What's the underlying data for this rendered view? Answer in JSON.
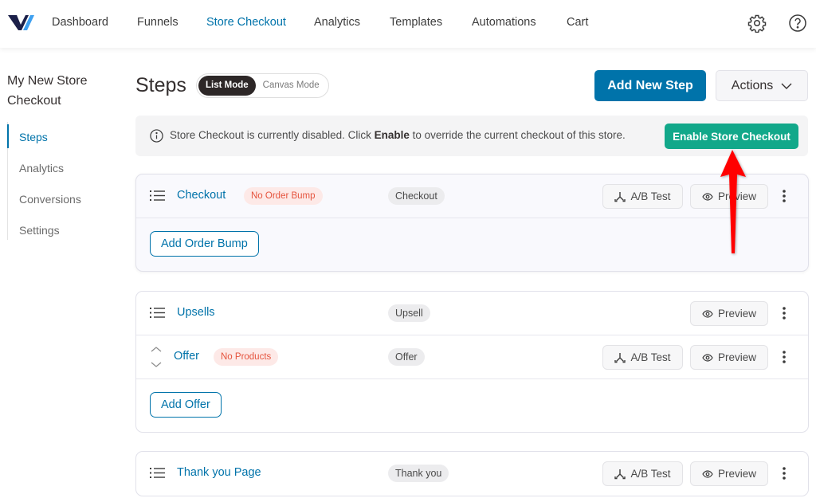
{
  "topnav": {
    "logo": "funnelkit-logo",
    "items": [
      {
        "label": "Dashboard",
        "active": false
      },
      {
        "label": "Funnels",
        "active": false
      },
      {
        "label": "Store Checkout",
        "active": true
      },
      {
        "label": "Analytics",
        "active": false
      },
      {
        "label": "Templates",
        "active": false
      },
      {
        "label": "Automations",
        "active": false
      },
      {
        "label": "Cart",
        "active": false
      }
    ],
    "icons": [
      "gear-icon",
      "help-icon"
    ]
  },
  "sidebar": {
    "title": "My New Store Checkout",
    "items": [
      {
        "label": "Steps",
        "active": true
      },
      {
        "label": "Analytics",
        "active": false
      },
      {
        "label": "Conversions",
        "active": false
      },
      {
        "label": "Settings",
        "active": false
      }
    ]
  },
  "header": {
    "title": "Steps",
    "modes": [
      {
        "label": "List Mode",
        "active": true
      },
      {
        "label": "Canvas Mode",
        "active": false
      }
    ],
    "add_step_label": "Add New Step",
    "actions_label": "Actions"
  },
  "notice": {
    "text_before": "Store Checkout is currently disabled. Click ",
    "text_bold": "Enable",
    "text_after": " to override the current checkout of this store.",
    "button_label": "Enable Store Checkout"
  },
  "colors": {
    "brand": "#0073aa",
    "success": "#12a88a",
    "warning": "#e5533d",
    "annotation_arrow": "#ff0000"
  },
  "steps": [
    {
      "name": "Checkout",
      "badge": "No Order Bump",
      "type": "Checkout",
      "ab_label": "A/B Test",
      "preview_label": "Preview",
      "footer_button": "Add Order Bump"
    },
    {
      "name": "Upsells",
      "type": "Upsell",
      "preview_label": "Preview",
      "offers": [
        {
          "name": "Offer",
          "badge": "No Products",
          "type": "Offer",
          "ab_label": "A/B Test",
          "preview_label": "Preview"
        }
      ],
      "footer_button": "Add Offer"
    },
    {
      "name": "Thank you Page",
      "type": "Thank you",
      "ab_label": "A/B Test",
      "preview_label": "Preview"
    }
  ]
}
